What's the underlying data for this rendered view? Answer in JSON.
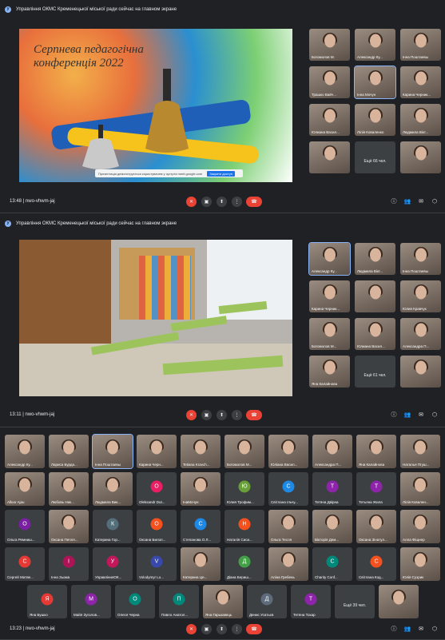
{
  "banner_text": "Управління ОКМС Кременецької міської ради сейчас на главном экране",
  "banner_badge": "У",
  "slide1": {
    "title_line1": "Серпнева педагогічна",
    "title_line2": "конференція 2022",
    "share_text": "Презентація демонструється користувачем у зустрічі meet.google.com",
    "share_button": "Закрити доступ"
  },
  "panel1": {
    "time": "13:48",
    "meeting_code": "nwo-vhwm-jaj",
    "tiles": [
      {
        "name": "Богомолов М.",
        "type": "photo"
      },
      {
        "name": "Александр Ку...",
        "type": "photo"
      },
      {
        "name": "Інна Поштаевы",
        "type": "photo"
      },
      {
        "name": "Трашко Вайч...",
        "type": "photo"
      },
      {
        "name": "Інна Мочун",
        "type": "photo",
        "highlight": true
      },
      {
        "name": "Карина Черник...",
        "type": "photo"
      },
      {
        "name": "Юлиана Васил...",
        "type": "photo"
      },
      {
        "name": "Лілія Коваленко",
        "type": "photo"
      },
      {
        "name": "Людмила Вікт...",
        "type": "photo"
      },
      {
        "name": "",
        "type": "photo"
      },
      {
        "name": "Ещё 66 чел.",
        "type": "more"
      },
      {
        "name": "",
        "type": "photo"
      }
    ]
  },
  "panel2": {
    "time": "13:11",
    "meeting_code": "nwo-vhwm-jaj",
    "tiles": [
      {
        "name": "Александр Ку...",
        "type": "photo",
        "highlight": true
      },
      {
        "name": "Людмила Вікт...",
        "type": "photo"
      },
      {
        "name": "Інна Поштаевы",
        "type": "photo"
      },
      {
        "name": "Карина Черник...",
        "type": "photo"
      },
      {
        "name": "",
        "type": "photo"
      },
      {
        "name": "Юлия Кравчук",
        "type": "photo"
      },
      {
        "name": "Богомолов М...",
        "type": "photo"
      },
      {
        "name": "Юлиана Васил...",
        "type": "photo"
      },
      {
        "name": "Александра П...",
        "type": "photo"
      },
      {
        "name": "Яна Калайнова",
        "type": "photo"
      },
      {
        "name": "Ещё 61 чел.",
        "type": "more"
      },
      {
        "name": "",
        "type": "photo"
      }
    ]
  },
  "panel3": {
    "time": "13:23",
    "meeting_code": "nwo-vhwm-jaj",
    "rows": [
      [
        {
          "name": "Александр Ку...",
          "type": "photo"
        },
        {
          "name": "Лариса Бурда...",
          "type": "photo"
        },
        {
          "name": "Інна Поштаевы",
          "type": "photo",
          "highlight": true
        },
        {
          "name": "Карина Черн...",
          "type": "photo"
        },
        {
          "name": "Tetiana Kravch...",
          "type": "photo"
        },
        {
          "name": "Богомолов М...",
          "type": "photo"
        },
        {
          "name": "Юліана Васил...",
          "type": "photo"
        },
        {
          "name": "Александра П...",
          "type": "photo"
        },
        {
          "name": "Яна Калайнова",
          "type": "photo"
        },
        {
          "name": "Наталья Пгуш...",
          "type": "photo"
        }
      ],
      [
        {
          "name": "Alloor Ajau",
          "type": "photo"
        },
        {
          "name": "Любовь Ник...",
          "type": "photo"
        },
        {
          "name": "Людмила Вик...",
          "type": "photo"
        },
        {
          "name": "Oleksandr Dut...",
          "type": "avatar",
          "initial": "O",
          "color": "#e91e63"
        },
        {
          "name": "ІнаМочун",
          "type": "photo"
        },
        {
          "name": "Юлия Трофим...",
          "type": "avatar",
          "initial": "Ю",
          "color": "#689f38"
        },
        {
          "name": "Світлана Ільчу...",
          "type": "avatar",
          "initial": "С",
          "color": "#1e88e5"
        },
        {
          "name": "Тетяна Двірна",
          "type": "avatar",
          "initial": "Т",
          "color": "#8e24aa"
        },
        {
          "name": "Тетьяна Жила",
          "type": "avatar",
          "initial": "Т",
          "color": "#8e24aa"
        },
        {
          "name": "Лілія Ковален...",
          "type": "photo"
        }
      ],
      [
        {
          "name": "Ольга Ремниш...",
          "type": "avatar",
          "initial": "О",
          "color": "#7b1fa2"
        },
        {
          "name": "Оксана Пепля...",
          "type": "photo"
        },
        {
          "name": "Катерина Гор...",
          "type": "avatar",
          "initial": "К",
          "color": "#546e7a"
        },
        {
          "name": "Оксана Билоп...",
          "type": "avatar",
          "initial": "О",
          "color": "#f4511e"
        },
        {
          "name": "Степанова О.Л...",
          "type": "avatar",
          "initial": "С",
          "color": "#1e88e5"
        },
        {
          "name": "Наталія Сиси...",
          "type": "avatar",
          "initial": "Н",
          "color": "#f4511e"
        },
        {
          "name": "Ольга Тесля",
          "type": "photo"
        },
        {
          "name": "Вікторія Дем...",
          "type": "photo"
        },
        {
          "name": "Оксана Зінатул...",
          "type": "photo"
        },
        {
          "name": "Алла Фіщнер",
          "type": "photo"
        }
      ],
      [
        {
          "name": "Сергей Матве...",
          "type": "avatar",
          "initial": "С",
          "color": "#e53935"
        },
        {
          "name": "Інна Зьома",
          "type": "avatar",
          "initial": "І",
          "color": "#ad1457"
        },
        {
          "name": "УправлінняОК...",
          "type": "avatar",
          "initial": "У",
          "color": "#c2185b"
        },
        {
          "name": "Volodymyr Lo...",
          "type": "avatar",
          "initial": "V",
          "color": "#3949ab"
        },
        {
          "name": "Катерина Це...",
          "type": "photo"
        },
        {
          "name": "Діана Бериш...",
          "type": "avatar",
          "initial": "Д",
          "color": "#43a047"
        },
        {
          "name": "Аліна Гребень",
          "type": "photo"
        },
        {
          "name": "Charity Conf...",
          "type": "avatar",
          "initial": "C",
          "color": "#00897b"
        },
        {
          "name": "Світлана Код...",
          "type": "avatar",
          "initial": "С",
          "color": "#f4511e"
        },
        {
          "name": "Юлія Сузрик",
          "type": "photo"
        }
      ],
      [
        {
          "name": "Яна Бушко",
          "type": "avatar",
          "initial": "Я",
          "color": "#e53935"
        },
        {
          "name": "Майя Зуголов...",
          "type": "avatar",
          "initial": "М",
          "color": "#8e24aa"
        },
        {
          "name": "Олеся Черна",
          "type": "avatar",
          "initial": "О",
          "color": "#00897b"
        },
        {
          "name": "Павло Анатол...",
          "type": "avatar",
          "initial": "П",
          "color": "#00897b"
        },
        {
          "name": "Яна Гарькавець",
          "type": "photo"
        },
        {
          "name": "Денис Усатьєв",
          "type": "avatar",
          "initial": "Д",
          "color": "#5e6b7a"
        },
        {
          "name": "Тетяна Тохар",
          "type": "avatar",
          "initial": "Т",
          "color": "#8e24aa"
        },
        {
          "name": "Ещё 39 чел.",
          "type": "more"
        },
        {
          "name": "",
          "type": "photo"
        }
      ]
    ]
  },
  "icons": {
    "mic": "🎤",
    "cam": "▣",
    "present": "⬆",
    "more": "⋮",
    "hangup": "☎",
    "info": "ⓘ",
    "people": "👥",
    "chat": "✉",
    "activities": "⬡"
  }
}
